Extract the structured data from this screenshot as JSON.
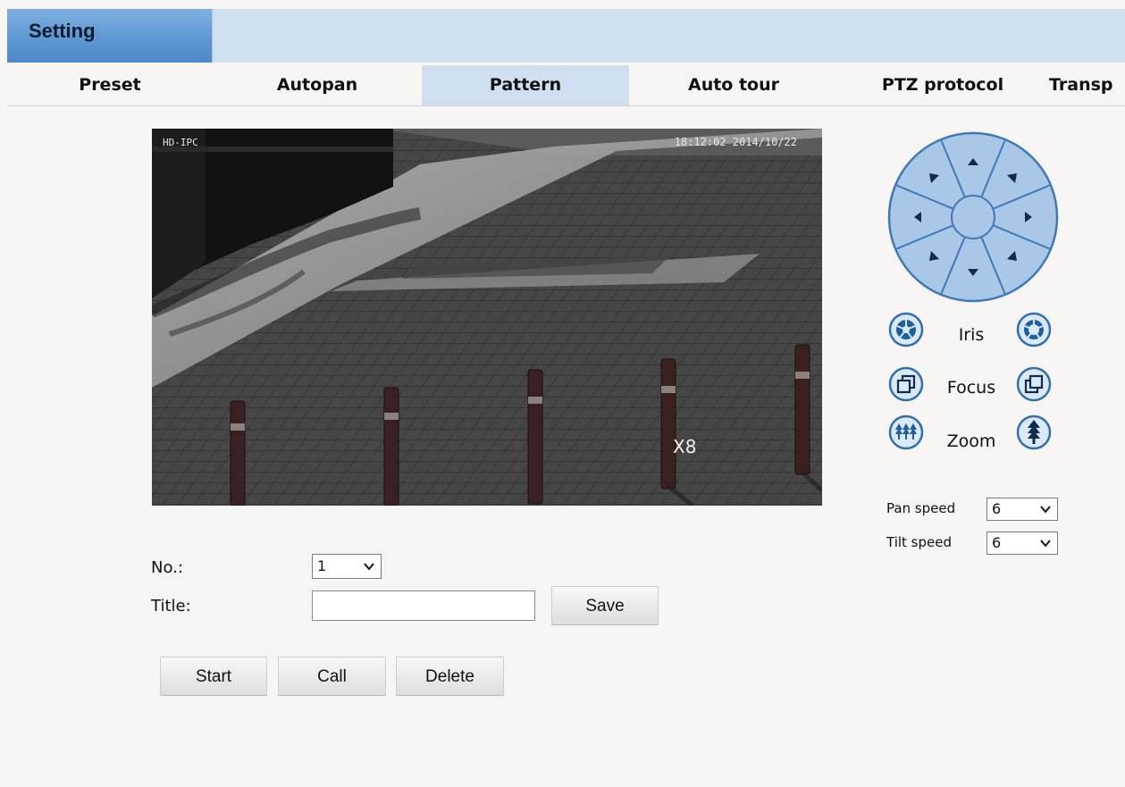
{
  "header": {
    "title": "Setting"
  },
  "tabs": [
    {
      "label": "Preset",
      "active": false
    },
    {
      "label": "Autopan",
      "active": false
    },
    {
      "label": "Pattern",
      "active": true
    },
    {
      "label": "Auto tour",
      "active": false
    },
    {
      "label": "PTZ protocol",
      "active": false
    },
    {
      "label": "Transp",
      "active": false
    }
  ],
  "video": {
    "camera_name": "HD-IPC",
    "timestamp": "18:12:02 2014/10/22",
    "zoom_text": "X8"
  },
  "ptz": {
    "iris_label": "Iris",
    "focus_label": "Focus",
    "zoom_label": "Zoom",
    "pan_speed_label": "Pan speed",
    "pan_speed_value": "6",
    "tilt_speed_label": "Tilt speed",
    "tilt_speed_value": "6"
  },
  "form": {
    "no_label": "No.:",
    "no_value": "1",
    "title_label": "Title:",
    "title_value": "",
    "save_label": "Save",
    "start_label": "Start",
    "call_label": "Call",
    "delete_label": "Delete"
  },
  "colors": {
    "header_bg": "#cfe0f0",
    "setting_tab": "#5e98d3",
    "active_tab": "#cfdff0",
    "ptz_blue": "#aac8e8",
    "icon_blue": "#1b5f9c"
  }
}
